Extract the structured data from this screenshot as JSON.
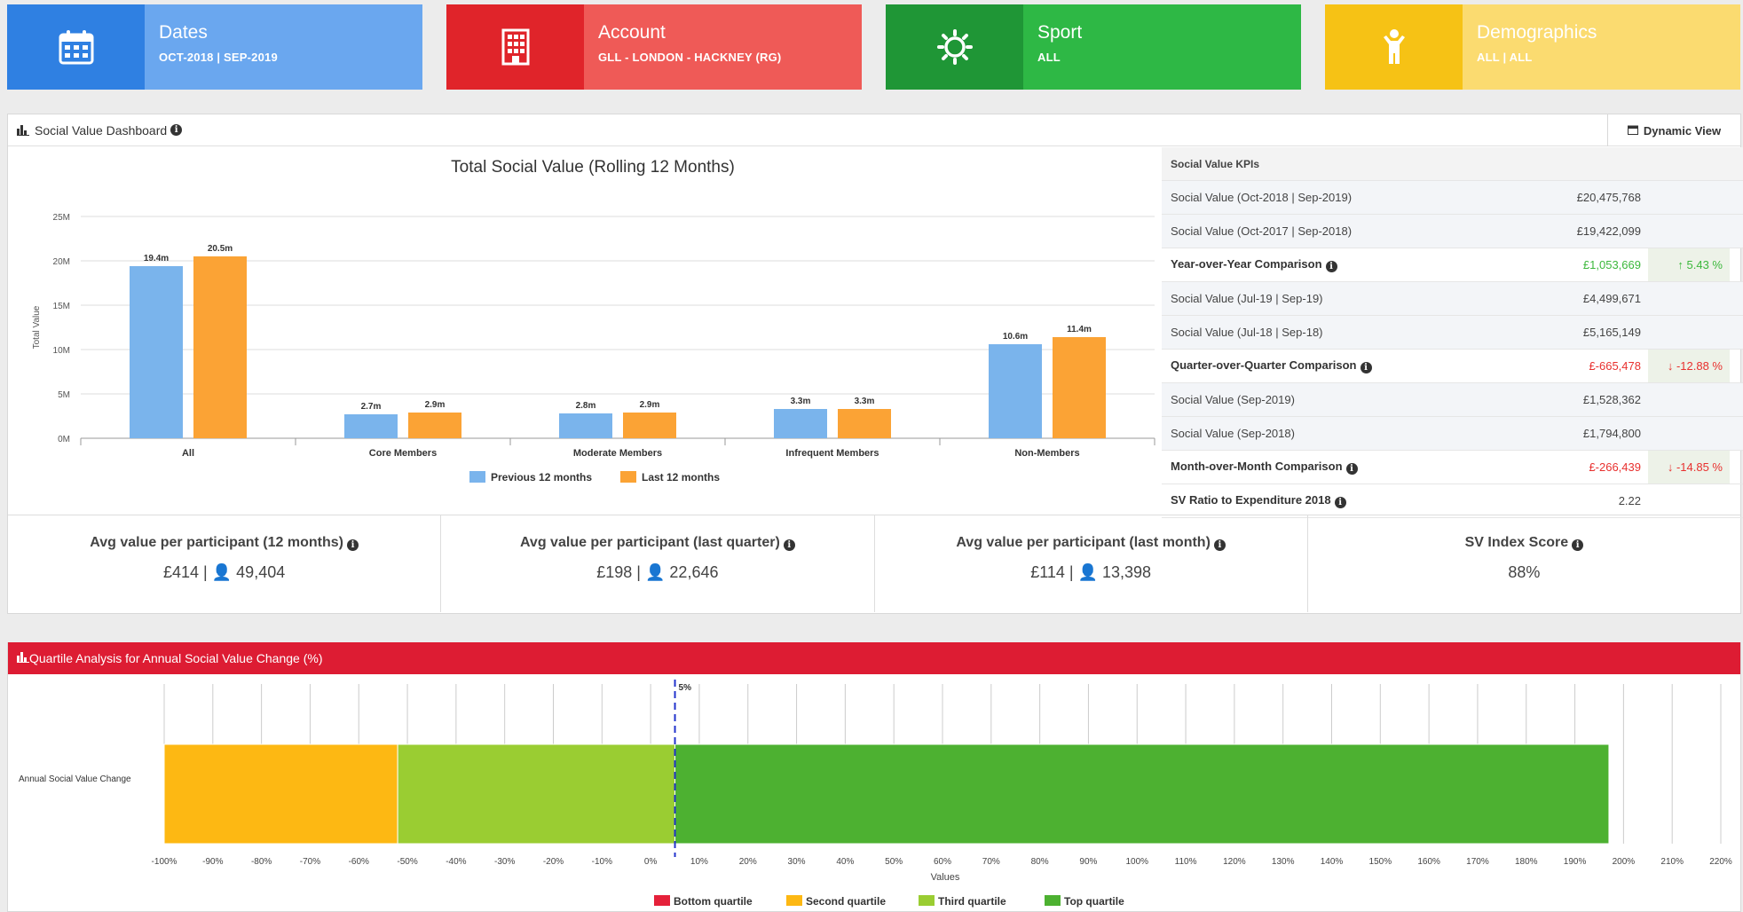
{
  "tiles": [
    {
      "title": "Dates",
      "value": "OCT-2018 | SEP-2019",
      "icon": "calendar-icon",
      "icon_bg": "#2f80e2",
      "bg": "#6aa7ef"
    },
    {
      "title": "Account",
      "value": "GLL - LONDON - HACKNEY (RG)",
      "icon": "building-icon",
      "icon_bg": "#e0242a",
      "bg": "#ef5a57"
    },
    {
      "title": "Sport",
      "value": "ALL",
      "icon": "sun-icon",
      "icon_bg": "#1f9636",
      "bg": "#2eb845"
    },
    {
      "title": "Demographics",
      "value": "ALL | ALL",
      "icon": "person-icon",
      "icon_bg": "#f6c215",
      "bg": "#fbdb70"
    }
  ],
  "panel1": {
    "title": "Social Value Dashboard",
    "dynamic_view": "Dynamic View"
  },
  "chart_data": {
    "type": "bar",
    "title": "Total Social Value (Rolling 12 Months)",
    "ylabel": "Total Value",
    "ylim": [
      0,
      25000000
    ],
    "yticks": [
      "0M",
      "5M",
      "10M",
      "15M",
      "20M",
      "25M"
    ],
    "categories": [
      "All",
      "Core Members",
      "Moderate Members",
      "Infrequent Members",
      "Non-Members"
    ],
    "series": [
      {
        "name": "Previous 12 months",
        "color": "#7ab4ec",
        "values": [
          19.4,
          2.7,
          2.8,
          3.3,
          10.6
        ],
        "labels": [
          "19.4m",
          "2.7m",
          "2.8m",
          "3.3m",
          "10.6m"
        ]
      },
      {
        "name": "Last 12 months",
        "color": "#fba335",
        "values": [
          20.5,
          2.9,
          2.9,
          3.3,
          11.4
        ],
        "labels": [
          "20.5m",
          "2.9m",
          "2.9m",
          "3.3m",
          "11.4m"
        ]
      }
    ],
    "legend": "bottom"
  },
  "kpis": {
    "header": "Social Value KPIs",
    "rows": [
      {
        "label": "Social Value (Oct-2018 | Sep-2019)",
        "value": "£20,475,768",
        "type": "alt"
      },
      {
        "label": "Social Value (Oct-2017 | Sep-2018)",
        "value": "£19,422,099",
        "type": "alt"
      },
      {
        "label": "Year-over-Year Comparison",
        "value": "£1,053,669",
        "change": "5.43 %",
        "dir": "up",
        "type": "bold"
      },
      {
        "label": "Social Value (Jul-19 | Sep-19)",
        "value": "£4,499,671",
        "type": "alt"
      },
      {
        "label": "Social Value (Jul-18 | Sep-18)",
        "value": "£5,165,149",
        "type": "alt"
      },
      {
        "label": "Quarter-over-Quarter Comparison",
        "value": "£-665,478",
        "change": "-12.88 %",
        "dir": "down",
        "type": "bold"
      },
      {
        "label": "Social Value (Sep-2019)",
        "value": "£1,528,362",
        "type": "alt"
      },
      {
        "label": "Social Value (Sep-2018)",
        "value": "£1,794,800",
        "type": "alt"
      },
      {
        "label": "Month-over-Month Comparison",
        "value": "£-266,439",
        "change": "-14.85 %",
        "dir": "down",
        "type": "bold"
      },
      {
        "label": "SV Ratio to Expenditure 2018",
        "value": "2.22",
        "type": "bold-plain"
      }
    ]
  },
  "stats": [
    {
      "title": "Avg value per participant (12 months)",
      "value": "£414",
      "people": "49,404"
    },
    {
      "title": "Avg value per participant (last quarter)",
      "value": "£198",
      "people": "22,646"
    },
    {
      "title": "Avg value per participant (last month)",
      "value": "£114",
      "people": "13,398"
    },
    {
      "title": "SV Index Score",
      "value": "88%",
      "people": ""
    }
  ],
  "panel2": {
    "title": "Quartile Analysis for Annual Social Value Change (%)"
  },
  "quartile_chart": {
    "type": "bar",
    "orientation": "horizontal-stacked",
    "category": "Annual Social Value Change",
    "xlabel": "Values",
    "xlim": [
      -100,
      220
    ],
    "xticks": [
      "-100%",
      "-90%",
      "-80%",
      "-70%",
      "-60%",
      "-50%",
      "-40%",
      "-30%",
      "-20%",
      "-10%",
      "0%",
      "10%",
      "20%",
      "30%",
      "40%",
      "50%",
      "60%",
      "70%",
      "80%",
      "90%",
      "100%",
      "110%",
      "120%",
      "130%",
      "140%",
      "150%",
      "160%",
      "170%",
      "180%",
      "190%",
      "200%",
      "210%",
      "220%"
    ],
    "segments": [
      {
        "name": "Second quartile",
        "from": -100,
        "to": -52,
        "color": "#fdb813"
      },
      {
        "name": "Third quartile",
        "from": -52,
        "to": 5,
        "color": "#9acd32"
      },
      {
        "name": "Top quartile",
        "from": 5,
        "to": 197,
        "color": "#4db131"
      }
    ],
    "marker": {
      "value": 5,
      "label": "5%"
    },
    "legend": [
      {
        "name": "Bottom quartile",
        "color": "#e5213a"
      },
      {
        "name": "Second quartile",
        "color": "#fdb813"
      },
      {
        "name": "Third quartile",
        "color": "#9acd32"
      },
      {
        "name": "Top quartile",
        "color": "#4db131"
      }
    ]
  }
}
